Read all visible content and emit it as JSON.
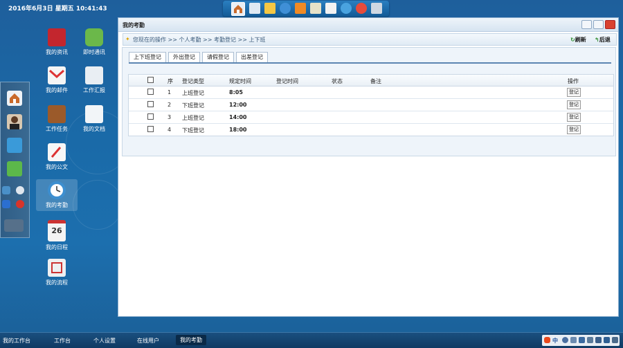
{
  "clock": "2016年6月3日 星期五 10:41:43",
  "quickbar_icons": [
    "home-icon",
    "desktop-icon",
    "mail-icon",
    "browser-icon",
    "rss-icon",
    "note-icon",
    "calendar-icon",
    "globe-icon",
    "lifebuoy-icon",
    "grid-icon"
  ],
  "sidebar_icons": [
    "home-icon",
    "user-avatar-icon",
    "group-icon",
    "refresh-icon",
    "monitor-icon",
    "phone-icon",
    "windows-icon",
    "close-icon",
    "shortcut-icon"
  ],
  "desktop": [
    {
      "label": "我的资讯",
      "icon": "news-icon"
    },
    {
      "label": "即时通讯",
      "icon": "im-icon"
    },
    {
      "label": "我的邮件",
      "icon": "gmail-icon"
    },
    {
      "label": "工作汇报",
      "icon": "report-icon"
    },
    {
      "label": "工作任务",
      "icon": "briefcase-icon"
    },
    {
      "label": "我的文档",
      "icon": "document-icon"
    },
    {
      "label": "我的公文",
      "icon": "official-doc-icon"
    },
    {
      "label": "我的考勤",
      "icon": "clock-icon"
    },
    {
      "label": "我的日程",
      "icon": "calendar-26-icon",
      "day": "26"
    },
    {
      "label": "我的流程",
      "icon": "workflow-icon"
    }
  ],
  "window": {
    "title": "我的考勤",
    "breadcrumb": "您现在的操作 >> 个人考勤 >> 考勤登记 >> 上下班",
    "refresh": "刷新",
    "back": "后退",
    "tabs": [
      "上下班登记",
      "外出登记",
      "请假登记",
      "出差登记"
    ],
    "columns": {
      "seq": "序",
      "type": "登记类型",
      "planned": "规定时间",
      "reg_time": "登记时间",
      "status": "状态",
      "note": "备注",
      "op": "操作"
    },
    "rows": [
      {
        "seq": "1",
        "type": "上班登记",
        "planned": "8:05",
        "btn": "登记"
      },
      {
        "seq": "2",
        "type": "下班登记",
        "planned": "12:00",
        "btn": "登记"
      },
      {
        "seq": "3",
        "type": "上班登记",
        "planned": "14:00",
        "btn": "登记"
      },
      {
        "seq": "4",
        "type": "下班登记",
        "planned": "18:00",
        "btn": "登记"
      }
    ]
  },
  "taskbar": [
    "我的工作台",
    "工作台",
    "个人设置",
    "在线用户",
    "我的考勤"
  ],
  "tray": {
    "ime": "中"
  }
}
